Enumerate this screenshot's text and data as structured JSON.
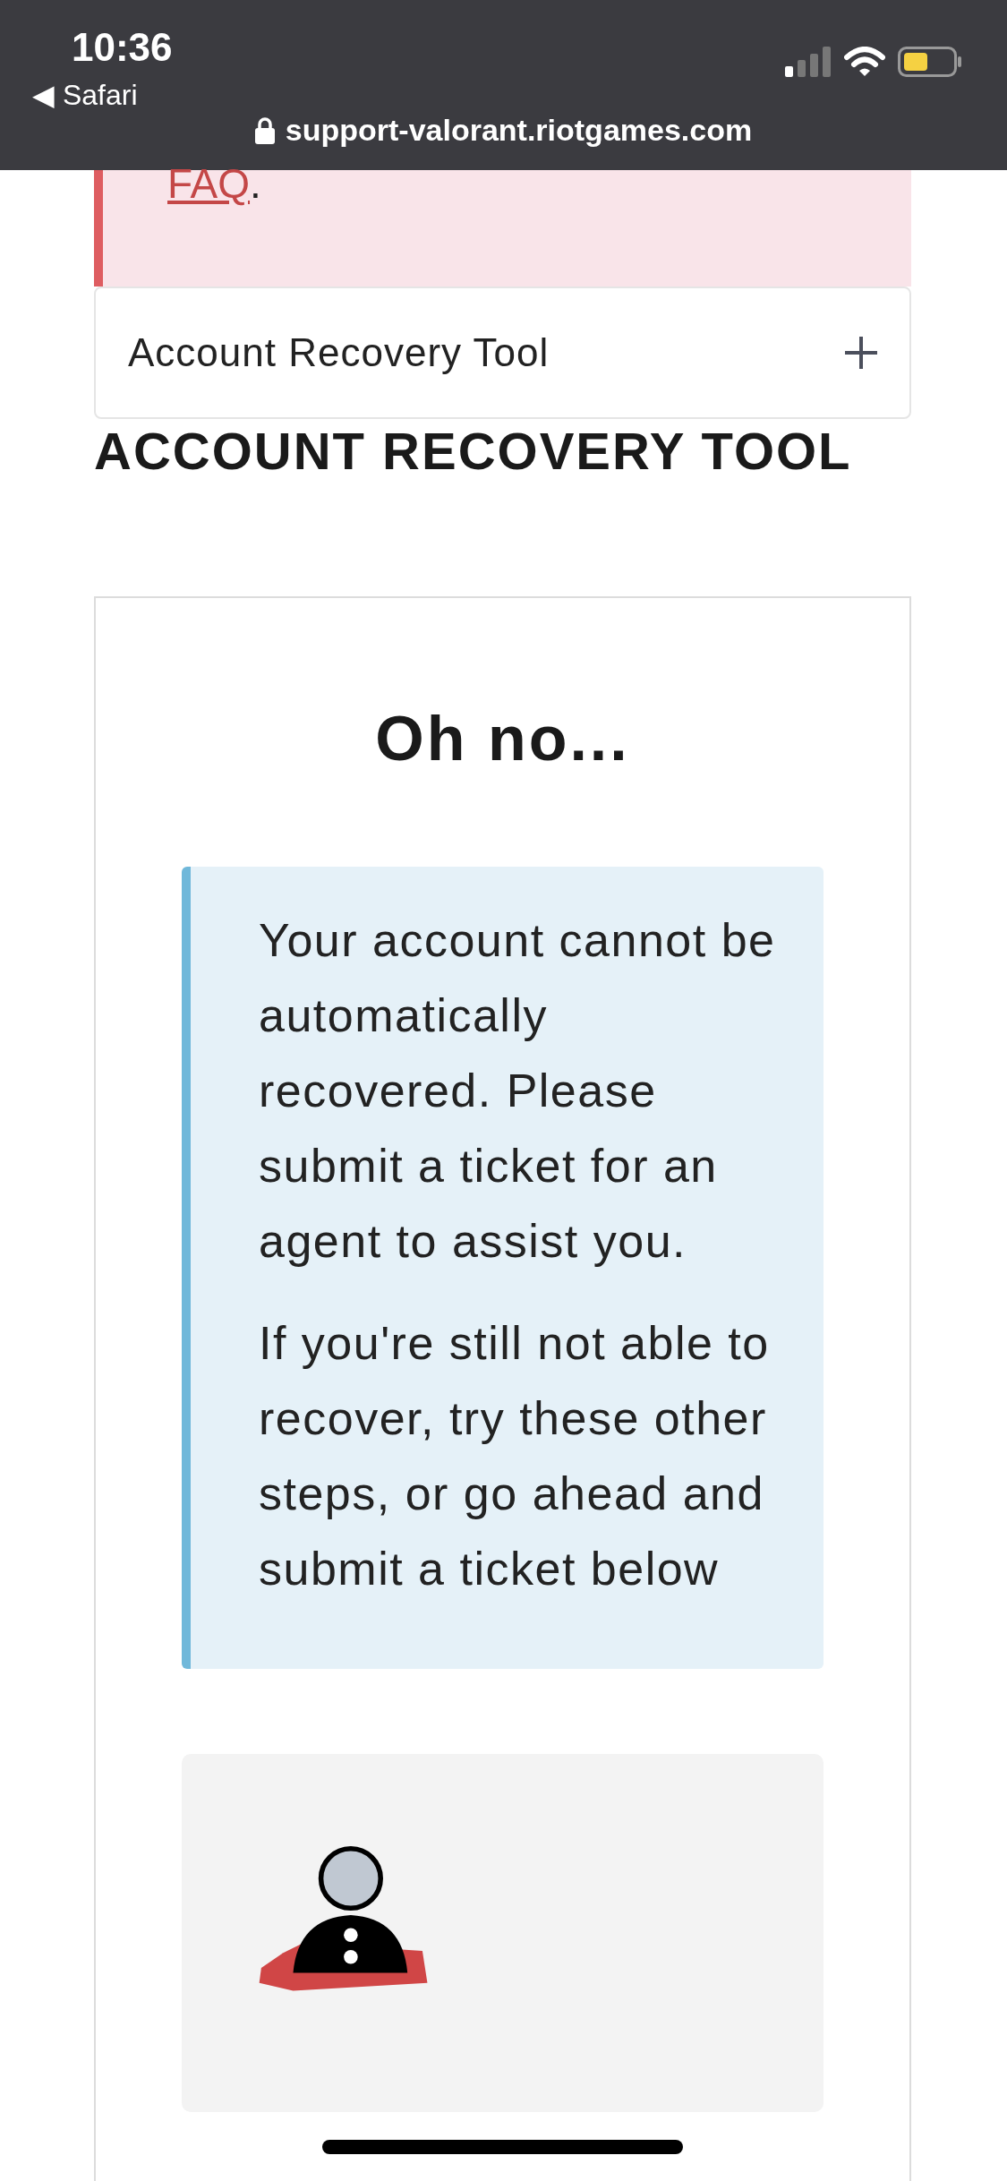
{
  "status_bar": {
    "time": "10:36",
    "back_label": "◀ Safari",
    "url": "support-valorant.riotgames.com"
  },
  "alert": {
    "link": "FAQ",
    "tail": "."
  },
  "accordion": {
    "title": "Account Recovery Tool",
    "expanded": false
  },
  "heading": "ACCOUNT RECOVERY TOOL",
  "card": {
    "title": "Oh no...",
    "messages": [
      "Your account cannot be automatically recovered. Please submit a ticket for an agent to assist you.",
      "If you're still not able to recover, try these other steps, or go ahead and submit a ticket below"
    ]
  }
}
